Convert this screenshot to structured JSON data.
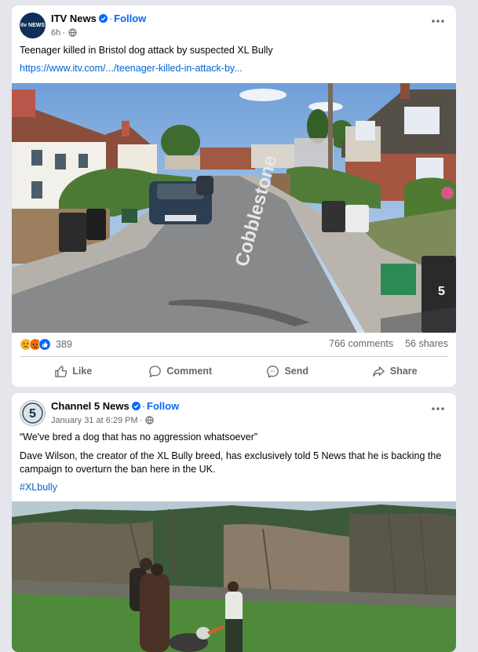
{
  "posts": [
    {
      "avatar_text": "itv NEWS",
      "author": "ITV News",
      "follow_label": "Follow",
      "time": "6h",
      "text": "Teenager killed in Bristol dog attack by suspected XL Bully",
      "link": "https://www.itv.com/.../teenager-killed-in-attack-by...",
      "photo_street_sign": "Cobblestone",
      "photo_bin_number": "5",
      "reaction_count": "389",
      "comments": "766 comments",
      "shares": "56 shares",
      "actions": {
        "like": "Like",
        "comment": "Comment",
        "send": "Send",
        "share": "Share"
      }
    },
    {
      "avatar_text": "5",
      "author": "Channel 5 News",
      "follow_label": "Follow",
      "time": "January 31 at 6:29 PM",
      "quote": "“We've bred a dog that has no aggression whatsoever”",
      "body": "Dave Wilson, the creator of the XL Bully breed, has exclusively told 5 News that he is backing the campaign to overturn the ban here in the UK.",
      "hashtag": "#XLbully"
    }
  ],
  "colors": {
    "link": "#0064d1",
    "follow": "#0866ff",
    "verified": "#0866ff",
    "background": "#e4e6eb"
  }
}
